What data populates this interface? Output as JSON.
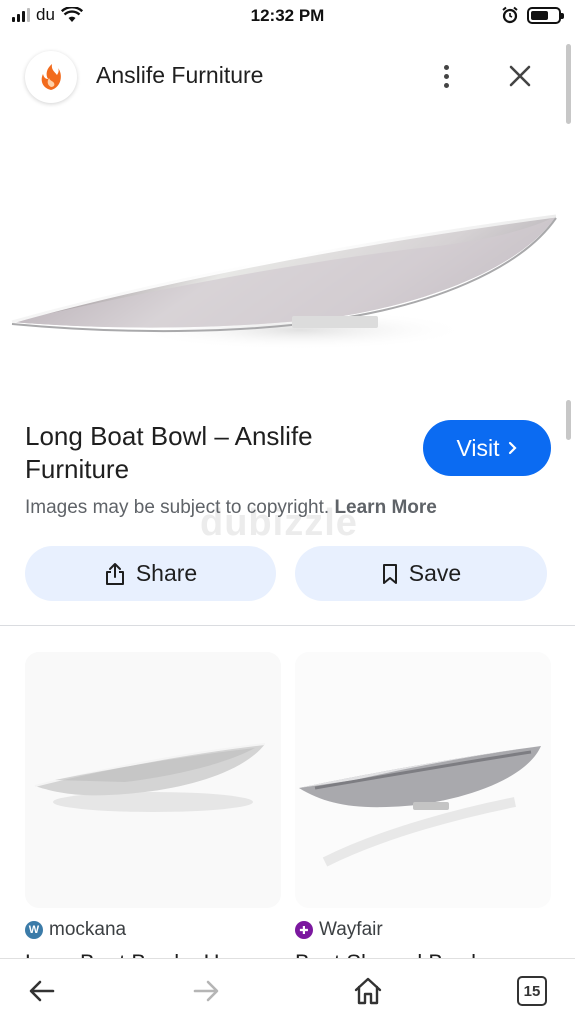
{
  "status_bar": {
    "carrier": "du",
    "time": "12:32 PM",
    "icons": [
      "signal-icon",
      "wifi-icon",
      "alarm-icon",
      "battery-icon"
    ]
  },
  "header": {
    "site_name": "Anslife Furniture",
    "logo_color": "#f26b1d",
    "more_icon": "more-vertical-icon",
    "close_icon": "close-icon"
  },
  "result": {
    "title": "Long Boat Bowl – Anslife Furniture",
    "visit_label": "Visit",
    "copyright_text": "Images may be subject to copyright.",
    "learn_more_label": "Learn More",
    "share_label": "Share",
    "save_label": "Save",
    "accent_color": "#0b6bf2"
  },
  "watermark": "dubizzle",
  "related": [
    {
      "source": "mockana",
      "title": "Long Boat Bowl – Home"
    },
    {
      "source": "Wayfair",
      "title": "Boat Shaped Bowl"
    }
  ],
  "bottom_nav": {
    "tab_count": "15",
    "icons": [
      "back-arrow-icon",
      "forward-arrow-icon",
      "home-icon",
      "tabs-icon"
    ]
  }
}
